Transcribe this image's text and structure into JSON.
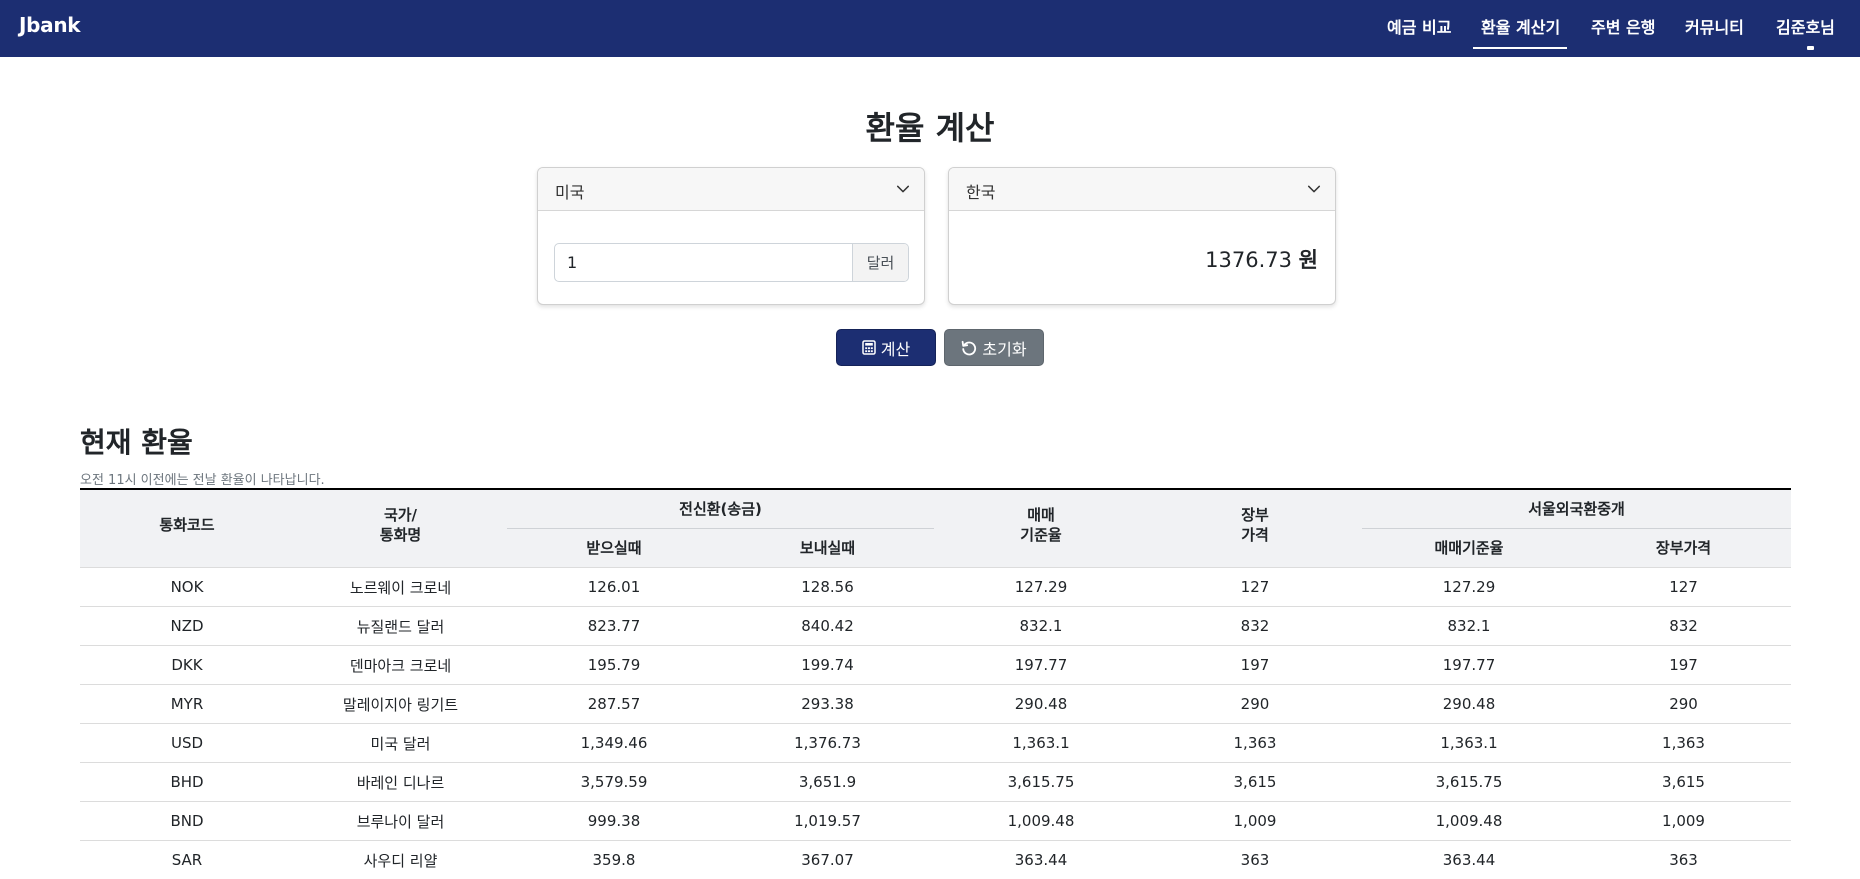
{
  "navbar": {
    "brand": "Jbank",
    "items": [
      {
        "label": "예금 비교"
      },
      {
        "label": "환율 계산기"
      },
      {
        "label": "주변 은행"
      },
      {
        "label": "커뮤니티"
      },
      {
        "label": "김준호님"
      }
    ],
    "active": "환율 계산기"
  },
  "calculator": {
    "title": "환율 계산",
    "from_country": "미국",
    "to_country": "한국",
    "amount": "1",
    "amount_unit": "달러",
    "result_value": "1376.73",
    "result_unit": "원",
    "calc_label": "계산",
    "reset_label": "초기화"
  },
  "rates": {
    "title": "현재 환율",
    "note": "오전 11시 이전에는 전날 환율이 나타납니다.",
    "headers": {
      "code": "통화코드",
      "country_line1": "국가/",
      "country_line2": "통화명",
      "tt_group": "전신환(송금)",
      "tt_buy": "받으실때",
      "tt_sell": "보내실때",
      "base_line1": "매매",
      "base_line2": "기준율",
      "book_line1": "장부",
      "book_line2": "가격",
      "seoul_group": "서울외국환중개",
      "seoul_base": "매매기준율",
      "seoul_book": "장부가격"
    },
    "rows": [
      [
        "NOK",
        "노르웨이 크로네",
        "126.01",
        "128.56",
        "127.29",
        "127",
        "127.29",
        "127"
      ],
      [
        "NZD",
        "뉴질랜드 달러",
        "823.77",
        "840.42",
        "832.1",
        "832",
        "832.1",
        "832"
      ],
      [
        "DKK",
        "덴마아크 크로네",
        "195.79",
        "199.74",
        "197.77",
        "197",
        "197.77",
        "197"
      ],
      [
        "MYR",
        "말레이지아 링기트",
        "287.57",
        "293.38",
        "290.48",
        "290",
        "290.48",
        "290"
      ],
      [
        "USD",
        "미국 달러",
        "1,349.46",
        "1,376.73",
        "1,363.1",
        "1,363",
        "1,363.1",
        "1,363"
      ],
      [
        "BHD",
        "바레인 디나르",
        "3,579.59",
        "3,651.9",
        "3,615.75",
        "3,615",
        "3,615.75",
        "3,615"
      ],
      [
        "BND",
        "브루나이 달러",
        "999.38",
        "1,019.57",
        "1,009.48",
        "1,009",
        "1,009.48",
        "1,009"
      ],
      [
        "SAR",
        "사우디 리얄",
        "359.8",
        "367.07",
        "363.44",
        "363",
        "363.44",
        "363"
      ]
    ]
  },
  "colors": {
    "navbar": "#1c2e72",
    "primary_button": "#1c2e72",
    "secondary_button": "#6c757d",
    "table_header": "#f1f2f4"
  }
}
